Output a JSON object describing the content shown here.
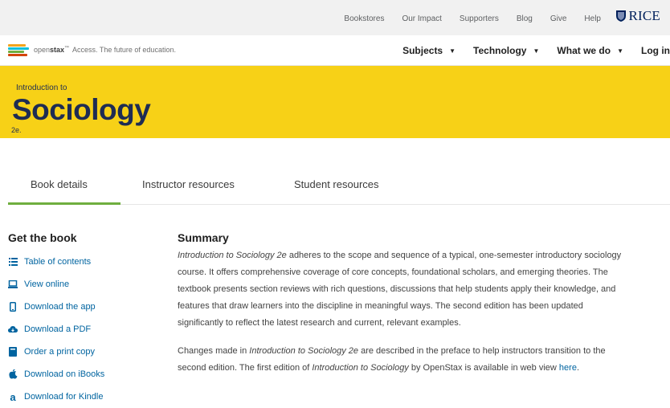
{
  "utility_nav": {
    "links": [
      "Bookstores",
      "Our Impact",
      "Supporters",
      "Blog",
      "Give",
      "Help"
    ],
    "rice_logo": "RICE"
  },
  "main_nav": {
    "logo": {
      "brand_prefix": "open",
      "brand_bold": "stax",
      "tm": "™",
      "tagline": "Access. The future of education."
    },
    "items": [
      {
        "label": "Subjects",
        "icon": "chevron-down-icon"
      },
      {
        "label": "Technology",
        "icon": "chevron-down-icon"
      },
      {
        "label": "What we do",
        "icon": "chevron-down-icon"
      }
    ],
    "login": "Log in"
  },
  "hero": {
    "intro": "Introduction to",
    "title": "Sociology",
    "edition": "2e.",
    "background": "#f7d117",
    "text_color": "#1e2c53"
  },
  "tabs": [
    {
      "label": "Book details",
      "active": true
    },
    {
      "label": "Instructor resources",
      "active": false
    },
    {
      "label": "Student resources",
      "active": false
    }
  ],
  "get_book": {
    "heading": "Get the book",
    "links": [
      {
        "label": "Table of contents",
        "icon": "list-icon"
      },
      {
        "label": "View online",
        "icon": "laptop-icon"
      },
      {
        "label": "Download the app",
        "icon": "phone-icon"
      },
      {
        "label": "Download a PDF",
        "icon": "cloud-download-icon"
      },
      {
        "label": "Order a print copy",
        "icon": "book-icon"
      },
      {
        "label": "Download on iBooks",
        "icon": "apple-icon"
      },
      {
        "label": "Download for Kindle",
        "icon": "amazon-icon"
      }
    ]
  },
  "summary": {
    "heading": "Summary",
    "p1_title": "Introduction to Sociology 2e",
    "p1_rest": " adheres to the scope and sequence of a typical, one-semester introductory sociology course. It offers comprehensive coverage of core concepts, foundational scholars, and emerging theories. The textbook presents section reviews with rich questions, discussions that help students apply their knowledge, and features that draw learners into the discipline in meaningful ways. The second edition has been updated significantly to reflect the latest research and current, relevant examples.",
    "p2_a": "Changes made in ",
    "p2_title1": "Introduction to Sociology 2e",
    "p2_b": " are described in the preface to help instructors transition to the second edition. The first edition of ",
    "p2_title2": "Introduction to Sociology",
    "p2_c": " by OpenStax is available in web view ",
    "p2_link": "here",
    "p2_end": "."
  },
  "colors": {
    "accent_green": "#6fae3f",
    "link_blue": "#0064a0"
  }
}
